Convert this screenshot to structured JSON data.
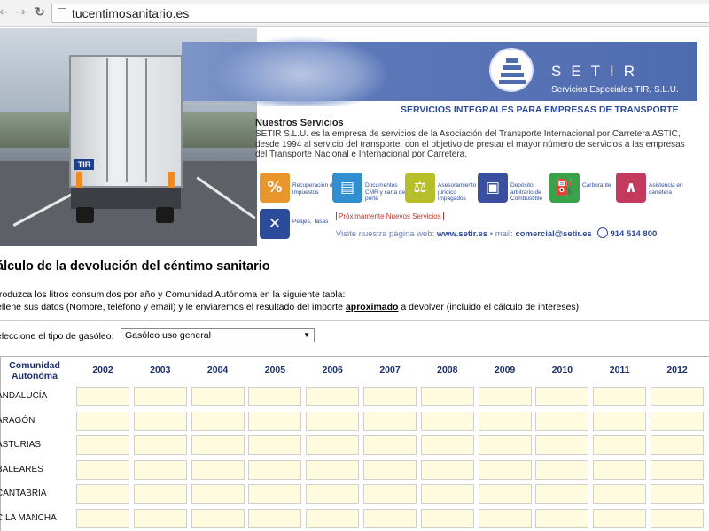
{
  "browser": {
    "url": "tucentimosanitario.es"
  },
  "banner": {
    "truck_plate": "TIR",
    "brand": "SETIR",
    "brand_subtitle": "Servicios Especiales TIR, S.L.U.",
    "tagline": "SERVICIOS INTEGRALES PARA EMPRESAS DE TRANSPORTE",
    "section_title": "Nuestros Servicios",
    "description": "SETIR S.L.U. es la empresa de servicios de la Asociación del Transporte Internacional por Carretera ASTIC, desde 1994 al servicio del transporte, con el objetivo de prestar el mayor número de servicios a las empresas del Transporte Nacional e Internacional por Carretera.",
    "services": [
      {
        "label": "Recuperación de impuestos",
        "icon": "percent-icon",
        "color": "#e8952b"
      },
      {
        "label": "Documentos CMR y carta de porte",
        "icon": "document-icon",
        "color": "#2f8fd0"
      },
      {
        "label": "Asesoramiento jurídico impagados",
        "icon": "scales-icon",
        "color": "#b6bf2a"
      },
      {
        "label": "Depósito arbitrario de Combustible",
        "icon": "lock-icon",
        "color": "#3a4fa0"
      },
      {
        "label": "Carburante",
        "icon": "fuel-icon",
        "color": "#3aa34a"
      },
      {
        "label": "Asistencia en carretera",
        "icon": "road-icon",
        "color": "#c43a5e"
      },
      {
        "label": "Peajes, Tasas",
        "icon": "toll-icon",
        "color": "#2d4b9b"
      }
    ],
    "coming_soon": "Próximamente Nuevos Servicios",
    "contact_prefix": "Visite nuestra página web:",
    "website": "www.setir.es",
    "mail_prefix": "• mail:",
    "email": "comercial@setir.es",
    "phone": "914 514 800"
  },
  "page": {
    "title": "álculo de la devolución del céntimo sanitario",
    "instruction_1": "troduzca los litros consumidos por año y Comunidad Autónoma en la siguiente tabla:",
    "instruction_2_before": "ellene sus datos (Nombre, teléfono y email) y le enviaremos el resultado del importe ",
    "instruction_2_bold": "aproximado",
    "instruction_2_after": " a devolver (incluido el cálculo de intereses).",
    "gasoleo_label": "eleccione el tipo de gasóleo:",
    "gasoleo_selected": "Gasóleo uso general"
  },
  "table": {
    "corner_header": "Comunidad Autonóma",
    "years": [
      "2002",
      "2003",
      "2004",
      "2005",
      "2006",
      "2007",
      "2008",
      "2009",
      "2010",
      "2011",
      "2012"
    ],
    "rows": [
      "ANDALUCÍA",
      "ARAGÓN",
      "ASTURIAS",
      "BALEARES",
      "CANTABRIA",
      "C.LA MANCHA"
    ]
  }
}
